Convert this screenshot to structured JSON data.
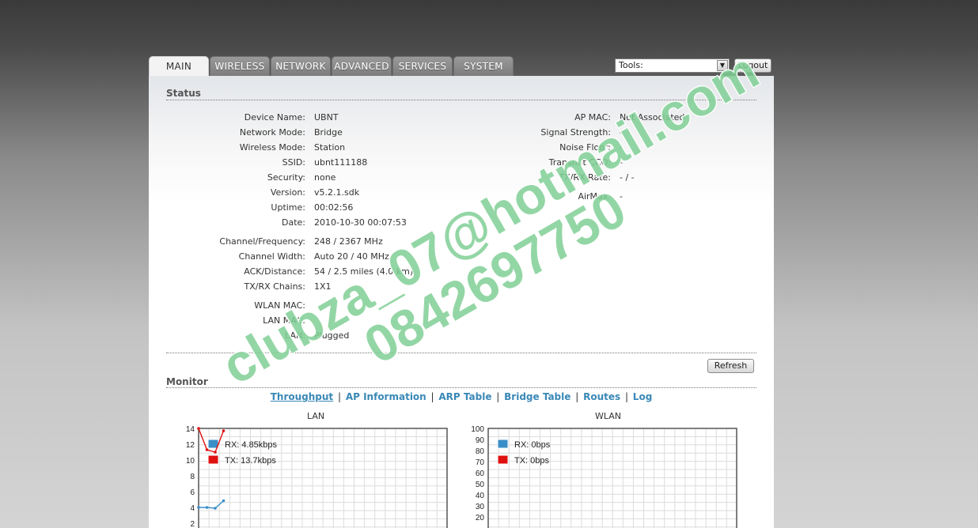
{
  "tabs": [
    {
      "label": "MAIN",
      "active": true
    },
    {
      "label": "WIRELESS",
      "active": false
    },
    {
      "label": "NETWORK",
      "active": false
    },
    {
      "label": "ADVANCED",
      "active": false
    },
    {
      "label": "SERVICES",
      "active": false
    },
    {
      "label": "SYSTEM",
      "active": false
    }
  ],
  "tools": {
    "selected": "Tools:"
  },
  "logout_label": "Logout",
  "status": {
    "title": "Status",
    "left": [
      {
        "label": "Device Name:",
        "value": "UBNT"
      },
      {
        "label": "Network Mode:",
        "value": "Bridge"
      },
      {
        "label": "Wireless Mode:",
        "value": "Station"
      },
      {
        "label": "SSID:",
        "value": "ubnt111188"
      },
      {
        "label": "Security:",
        "value": "none"
      },
      {
        "label": "Version:",
        "value": "v5.2.1.sdk"
      },
      {
        "label": "Uptime:",
        "value": "00:02:56"
      },
      {
        "label": "Date:",
        "value": "2010-10-30 00:07:53"
      },
      {
        "label": "Channel/Frequency:",
        "value": "248 / 2367 MHz"
      },
      {
        "label": "Channel Width:",
        "value": "Auto 20 / 40 MHz"
      },
      {
        "label": "ACK/Distance:",
        "value": "54 / 2.5 miles (4.0 km)"
      },
      {
        "label": "TX/RX Chains:",
        "value": "1X1"
      },
      {
        "label": "WLAN MAC:",
        "value": ""
      },
      {
        "label": "LAN MAC:",
        "value": ""
      },
      {
        "label": "LAN:",
        "value": "Plugged"
      }
    ],
    "right": [
      {
        "label": "AP MAC:",
        "value": "Not Associated"
      },
      {
        "label": "Signal Strength:",
        "value": "-"
      },
      {
        "label": "Noise Floor:",
        "value": "-"
      },
      {
        "label": "Transmit CCQ:",
        "value": "-"
      },
      {
        "label": "TX/RX Rate:",
        "value": "- / -"
      },
      {
        "label": "AirMax:",
        "value": "-"
      }
    ]
  },
  "refresh_label": "Refresh",
  "monitor": {
    "title": "Monitor",
    "links": [
      {
        "label": "Throughput",
        "active": true
      },
      {
        "label": "AP Information",
        "active": false
      },
      {
        "label": "ARP Table",
        "active": false
      },
      {
        "label": "Bridge Table",
        "active": false
      },
      {
        "label": "Routes",
        "active": false
      },
      {
        "label": "Log",
        "active": false
      }
    ]
  },
  "watermark": {
    "line1": "clubza_07@hotmail.com",
    "line2": "0842697750",
    "color": "#4fbf6a"
  },
  "chart_data": [
    {
      "type": "line",
      "title": "LAN",
      "yticks": [
        14,
        12,
        10,
        8,
        6,
        4,
        2
      ],
      "ylim": [
        0,
        14
      ],
      "grid": true,
      "legend_position": "top-left",
      "series": [
        {
          "name": "RX: 4.85kbps",
          "color": "#3a8ec8",
          "x": [
            0,
            1,
            2,
            3
          ],
          "values": [
            4.0,
            4.0,
            3.9,
            4.85
          ]
        },
        {
          "name": "TX: 13.7kbps",
          "color": "#e01010",
          "x": [
            0,
            1,
            2,
            3
          ],
          "values": [
            14.0,
            11.3,
            11.0,
            13.7
          ]
        }
      ]
    },
    {
      "type": "line",
      "title": "WLAN",
      "yticks": [
        100,
        90,
        80,
        70,
        60,
        50,
        40,
        30,
        20
      ],
      "ylim": [
        0,
        100
      ],
      "grid": true,
      "legend_position": "top-left",
      "series": [
        {
          "name": "RX: 0bps",
          "color": "#3a8ec8",
          "values": []
        },
        {
          "name": "TX: 0bps",
          "color": "#e01010",
          "values": []
        }
      ]
    }
  ]
}
